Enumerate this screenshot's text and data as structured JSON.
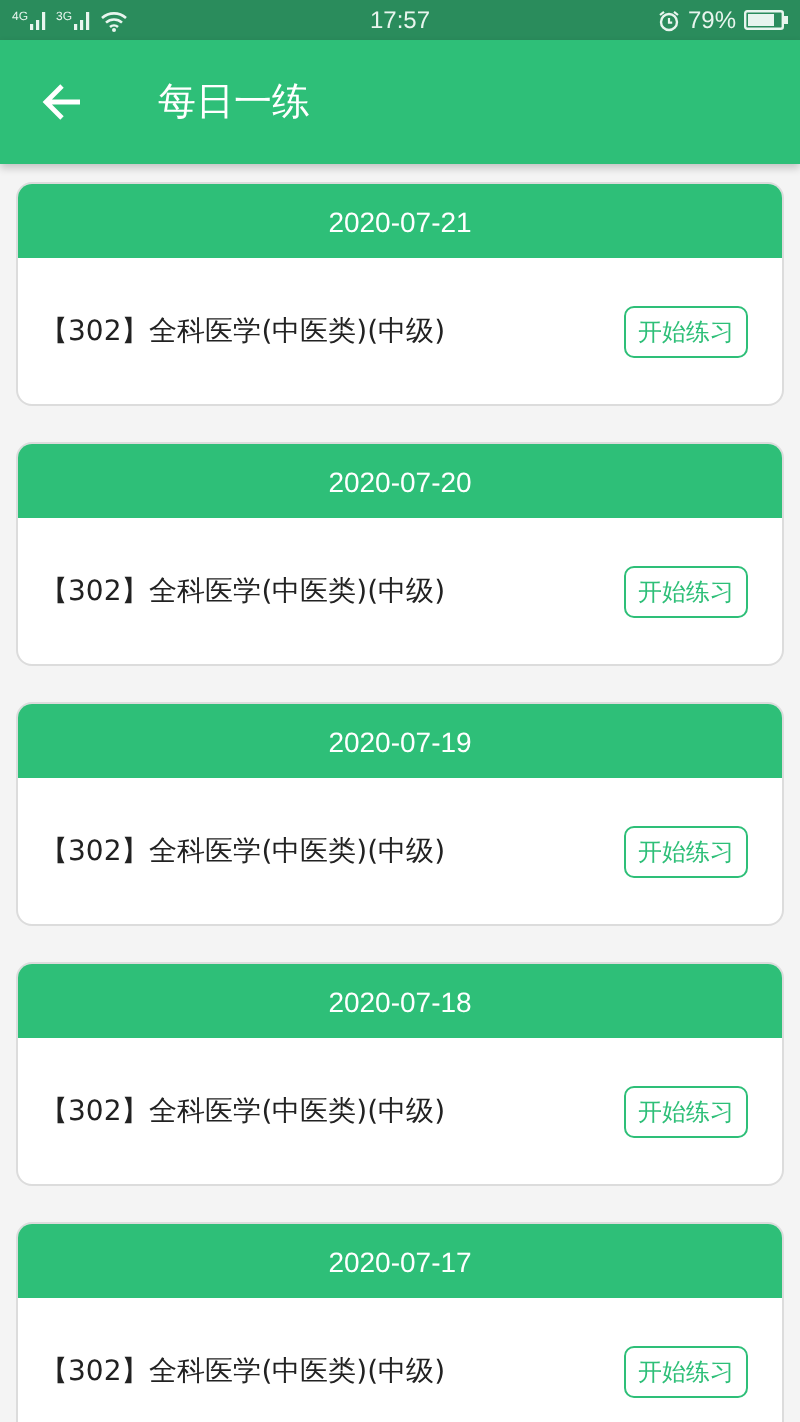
{
  "status_bar": {
    "network_1": "4G",
    "network_2": "3G",
    "time": "17:57",
    "battery": "79%"
  },
  "app_bar": {
    "title": "每日一练"
  },
  "practices": [
    {
      "date": "2020-07-21",
      "subject": "【302】全科医学(中医类)(中级)",
      "button": "开始练习"
    },
    {
      "date": "2020-07-20",
      "subject": "【302】全科医学(中医类)(中级)",
      "button": "开始练习"
    },
    {
      "date": "2020-07-19",
      "subject": "【302】全科医学(中医类)(中级)",
      "button": "开始练习"
    },
    {
      "date": "2020-07-18",
      "subject": "【302】全科医学(中医类)(中级)",
      "button": "开始练习"
    },
    {
      "date": "2020-07-17",
      "subject": "【302】全科医学(中医类)(中级)",
      "button": "开始练习"
    }
  ]
}
